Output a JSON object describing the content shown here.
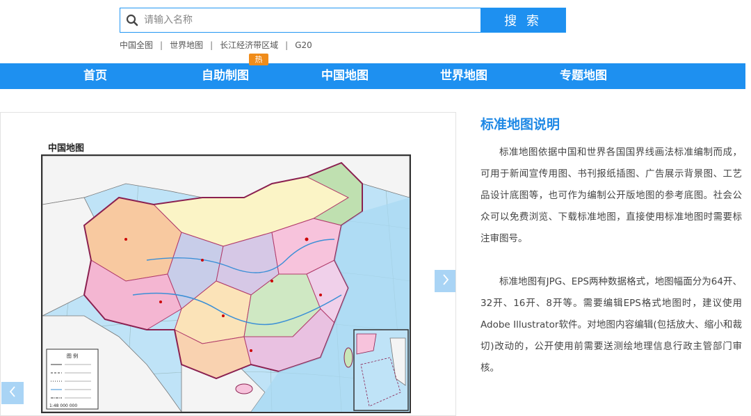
{
  "search": {
    "placeholder": "请输入名称",
    "value": "",
    "button_label": "搜 索"
  },
  "quick_links": [
    "中国全图",
    "世界地图",
    "长江经济带区域",
    "G20"
  ],
  "quick_sep": "|",
  "hot_badge": "热",
  "nav": {
    "items": [
      "首页",
      "自助制图",
      "中国地图",
      "世界地图",
      "专题地图"
    ]
  },
  "map": {
    "title": "中国地图",
    "scale": "1:48 000 000",
    "legend_title": "图 例"
  },
  "colors": {
    "accent": "#1e90f0",
    "hot": "#f08c1a",
    "title_blue": "#1e88e5"
  },
  "description": {
    "title": "标准地图说明",
    "paragraphs": [
      "标准地图依据中国和世界各国国界线画法标准编制而成，可用于新闻宣传用图、书刊报纸插图、广告展示背景图、工艺品设计底图等，也可作为编制公开版地图的参考底图。社会公众可以免费浏览、下载标准地图，直接使用标准地图时需要标注审图号。",
      "标准地图有JPG、EPS两种数据格式，地图幅面分为64开、32开、16开、8开等。需要编辑EPS格式地图时，建议使用Adobe Illustrator软件。对地图内容编辑(包括放大、缩小和裁切)改动的，公开使用前需要送测绘地理信息行政主管部门审核。"
    ]
  }
}
